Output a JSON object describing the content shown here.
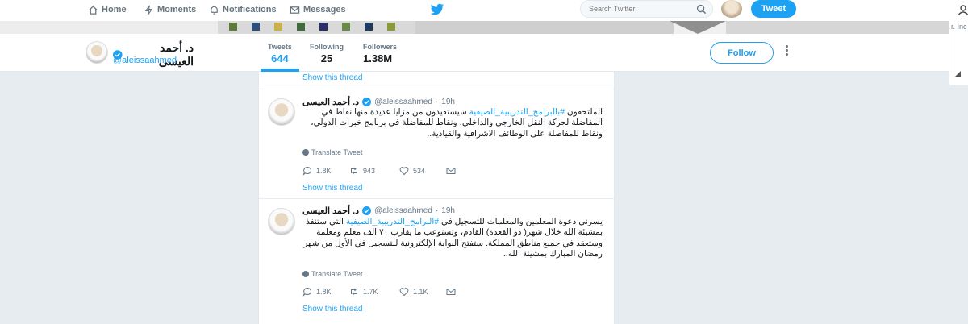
{
  "nav": {
    "home": "Home",
    "moments": "Moments",
    "notifications": "Notifications",
    "messages": "Messages",
    "search_placeholder": "Search Twitter",
    "tweet_button": "Tweet",
    "accent": "#1da1f2"
  },
  "right_panel": {
    "text": "r. Inc"
  },
  "profile": {
    "name": "د. أحمد العيسى",
    "handle": "@aleissaahmed",
    "stats": [
      {
        "label": "Tweets",
        "value": "644"
      },
      {
        "label": "Following",
        "value": "25"
      },
      {
        "label": "Followers",
        "value": "1.38M"
      }
    ],
    "follow_label": "Follow"
  },
  "timeline": {
    "top_thread_link": "Show this thread",
    "tweets": [
      {
        "name": "د. أحمد العيسى",
        "handle": "@aleissaahmed",
        "dot": "·",
        "time": "19h",
        "body_pre": "الملتحقون ",
        "hashtag": "#بالبرامج_التدريبية_الصيفية",
        "body_post": " سيستفيدون من مزايا عديدة منها نقاط في المفاضلة لحركة النقل الخارجي والداخلي، ونقاط للمفاضلة في برنامج خبرات الدولي، ونقاط للمفاضلة على الوظائف الاشرافية والقيادية..",
        "translate": "Translate Tweet",
        "replies": "1.8K",
        "retweets": "943",
        "likes": "534",
        "thread_link": "Show this thread"
      },
      {
        "name": "د. أحمد العيسى",
        "handle": "@aleissaahmed",
        "dot": "·",
        "time": "19h",
        "body_pre": "يسرني دعوة المعلمين والمعلمات للتسجيل في ",
        "hashtag": "#البرامج_التدريبية_الصيفية",
        "body_post": " التي ستنفذ بمشيئة الله خلال شهر( ذو القعدة) القادم، وتستوعب ما يقارب ٧٠ الف معلم ومعلمة وستعقد في جميع مناطق المملكة. ستفتح البوابة الإلكترونية للتسجيل في الأول من شهر رمضان المبارك بمشيئة الله..",
        "translate": "Translate Tweet",
        "replies": "1.8K",
        "retweets": "1.7K",
        "likes": "1.1K",
        "thread_link": "Show this thread"
      }
    ]
  }
}
